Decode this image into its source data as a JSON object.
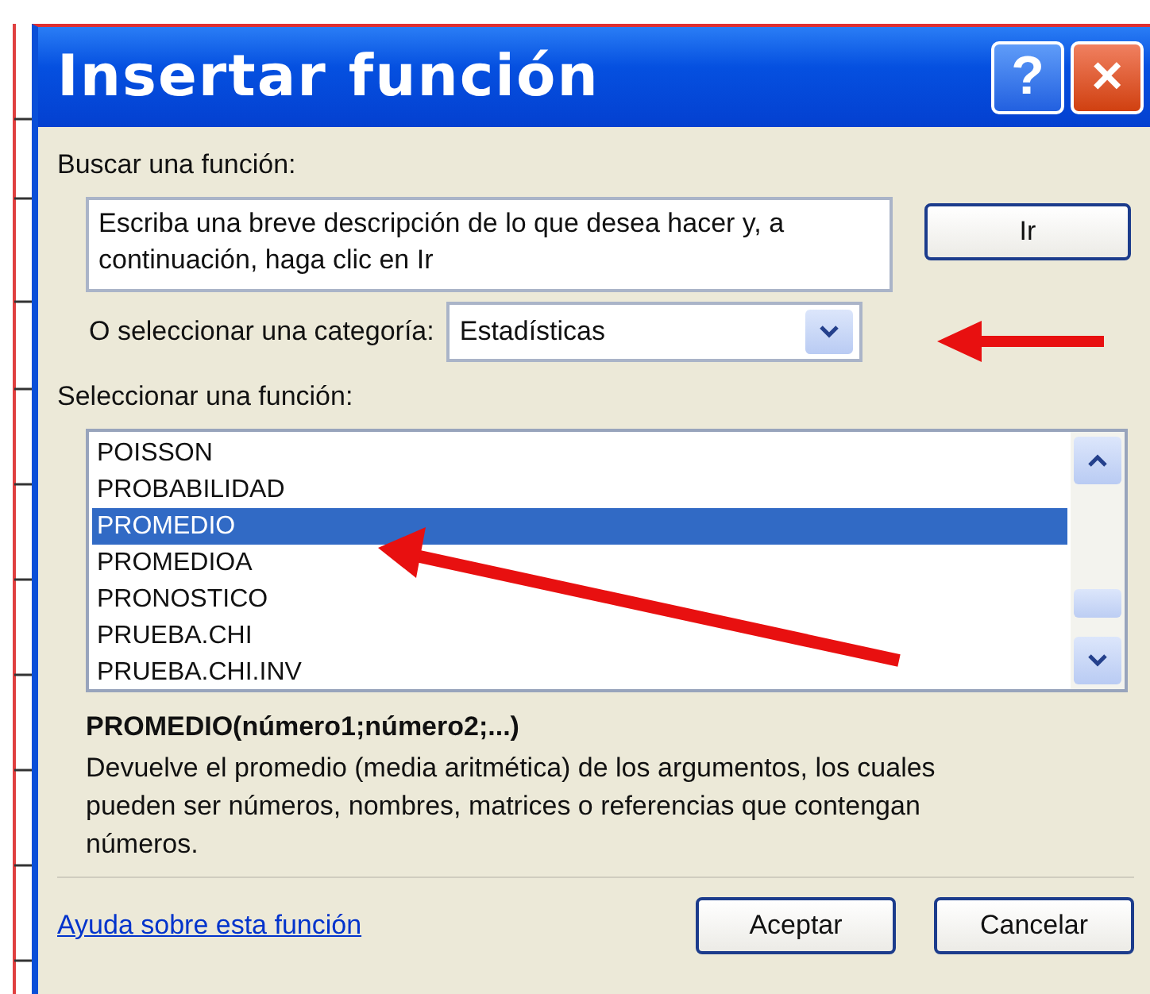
{
  "window": {
    "title": "Insertar función",
    "help_button": "?",
    "close_button": "×"
  },
  "search": {
    "label": "Buscar una función:",
    "value": "Escriba una breve descripción de lo que desea hacer y, a continuación, haga clic en Ir",
    "go_button": "Ir"
  },
  "category": {
    "label": "O seleccionar una categoría:",
    "value": "Estadísticas"
  },
  "functions": {
    "label": "Seleccionar una función:",
    "items": [
      {
        "name": "POISSON",
        "selected": false
      },
      {
        "name": "PROBABILIDAD",
        "selected": false
      },
      {
        "name": "PROMEDIO",
        "selected": true
      },
      {
        "name": "PROMEDIOA",
        "selected": false
      },
      {
        "name": "PRONOSTICO",
        "selected": false
      },
      {
        "name": "PRUEBA.CHI",
        "selected": false
      },
      {
        "name": "PRUEBA.CHI.INV",
        "selected": false
      }
    ]
  },
  "signature": "PROMEDIO(número1;número2;...)",
  "description": "Devuelve el promedio (media aritmética) de los argumentos, los cuales pueden ser números, nombres, matrices o referencias que contengan números.",
  "help_link": "Ayuda sobre esta función",
  "buttons": [
    "Aceptar",
    "Cancelar"
  ]
}
